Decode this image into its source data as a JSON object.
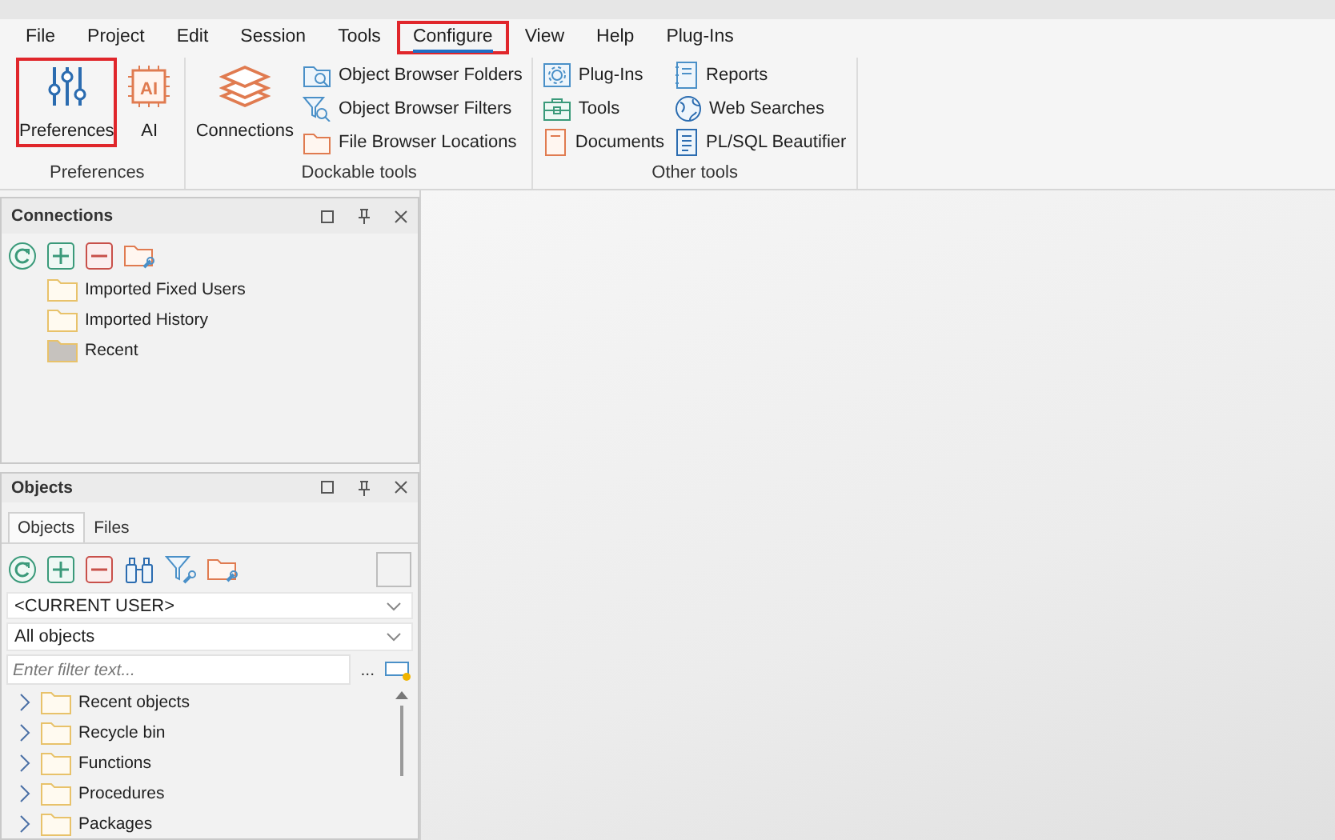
{
  "menu": [
    {
      "label": "File",
      "selected": false,
      "highlighted": false
    },
    {
      "label": "Project",
      "selected": false,
      "highlighted": false
    },
    {
      "label": "Edit",
      "selected": false,
      "highlighted": false
    },
    {
      "label": "Session",
      "selected": false,
      "highlighted": false
    },
    {
      "label": "Tools",
      "selected": false,
      "highlighted": false
    },
    {
      "label": "Configure",
      "selected": true,
      "highlighted": true
    },
    {
      "label": "View",
      "selected": false,
      "highlighted": false
    },
    {
      "label": "Help",
      "selected": false,
      "highlighted": false
    },
    {
      "label": "Plug-Ins",
      "selected": false,
      "highlighted": false
    }
  ],
  "ribbon": {
    "groups": [
      {
        "label": "Preferences",
        "items": [
          {
            "label": "Preferences",
            "kind": "large",
            "highlighted": true
          },
          {
            "label": "AI",
            "kind": "large",
            "highlighted": false,
            "icon_text": "AI"
          }
        ]
      },
      {
        "label": "Dockable tools",
        "items": [
          {
            "label": "Connections",
            "kind": "large",
            "highlighted": false
          },
          {
            "label": "Object Browser Folders",
            "kind": "small",
            "highlighted": false
          },
          {
            "label": "Object Browser Filters",
            "kind": "small",
            "highlighted": false
          },
          {
            "label": "File Browser Locations",
            "kind": "small",
            "highlighted": false
          }
        ]
      },
      {
        "label": "Other tools",
        "items": [
          {
            "label": "Plug-Ins",
            "kind": "small",
            "highlighted": false
          },
          {
            "label": "Tools",
            "kind": "small",
            "highlighted": false
          },
          {
            "label": "Documents",
            "kind": "small",
            "highlighted": false
          },
          {
            "label": "Reports",
            "kind": "small",
            "highlighted": false
          },
          {
            "label": "Web Searches",
            "kind": "small",
            "highlighted": false
          },
          {
            "label": "PL/SQL Beautifier",
            "kind": "small",
            "highlighted": false
          }
        ]
      }
    ]
  },
  "connections": {
    "title": "Connections",
    "items": [
      {
        "label": "Imported Fixed Users",
        "kind": "folder"
      },
      {
        "label": "Imported History",
        "kind": "folder"
      },
      {
        "label": "Recent",
        "kind": "filled-folder"
      }
    ]
  },
  "objects": {
    "title": "Objects",
    "tabs": [
      {
        "label": "Objects",
        "selected": true
      },
      {
        "label": "Files",
        "selected": false
      }
    ],
    "owner": {
      "value": "<CURRENT USER>"
    },
    "filter_kind": {
      "value": "All objects"
    },
    "filter": {
      "placeholder": "Enter filter text..."
    },
    "more": "...",
    "tree": [
      {
        "label": "Recent objects",
        "expanded": false
      },
      {
        "label": "Recycle bin",
        "expanded": false
      },
      {
        "label": "Functions",
        "expanded": false
      },
      {
        "label": "Procedures",
        "expanded": false
      },
      {
        "label": "Packages",
        "expanded": false
      }
    ]
  }
}
